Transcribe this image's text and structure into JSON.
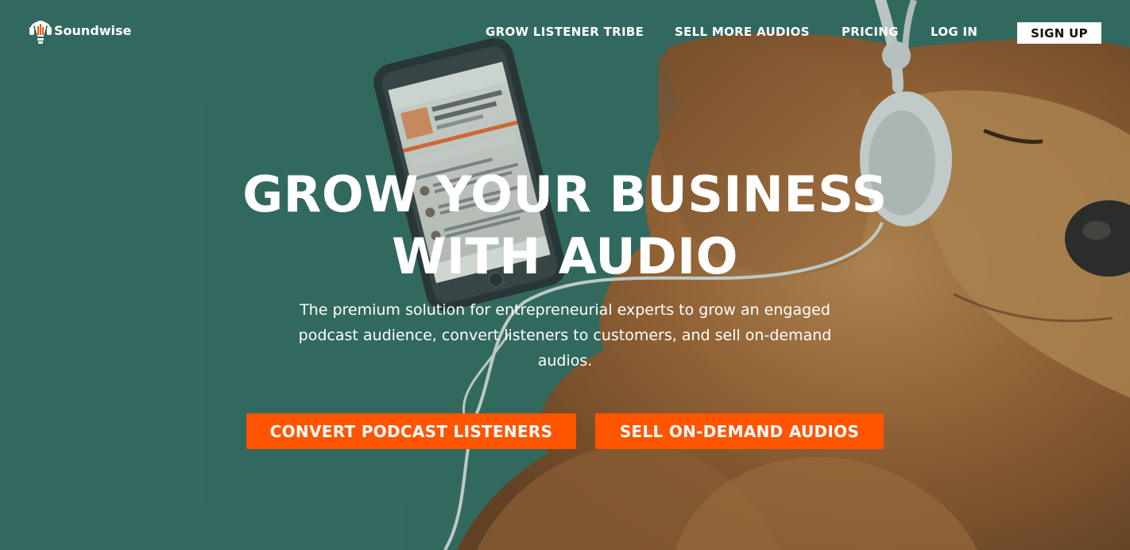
{
  "brand": {
    "name": "Soundwise",
    "logo_icon": "headphones-bulb-icon"
  },
  "nav": {
    "items": [
      {
        "label": "GROW LISTENER TRIBE"
      },
      {
        "label": "SELL MORE AUDIOS"
      },
      {
        "label": "PRICING"
      },
      {
        "label": "LOG IN"
      }
    ],
    "signup_label": "SIGN UP"
  },
  "hero": {
    "headline_line1": "GROW YOUR BUSINESS",
    "headline_line2": "WITH AUDIO",
    "subhead": "The premium solution for entrepreneurial experts to grow an engaged podcast audience, convert listeners to customers, and sell on-demand audios.",
    "cta_primary": "CONVERT PODCAST LISTENERS",
    "cta_secondary": "SELL ON-DEMAND AUDIOS"
  },
  "colors": {
    "background": "#346b61",
    "accent": "#ff5400",
    "text": "#ffffff"
  }
}
